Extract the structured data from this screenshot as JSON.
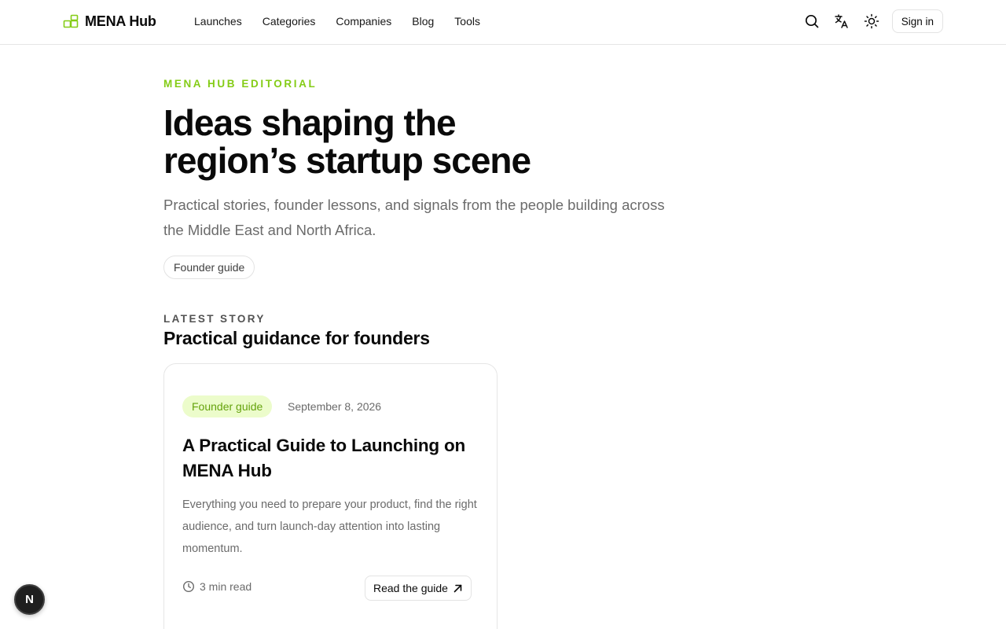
{
  "header": {
    "brand": "MENA Hub",
    "nav": [
      "Launches",
      "Categories",
      "Companies",
      "Blog",
      "Tools"
    ],
    "icons": [
      "search-icon",
      "translate-icon",
      "sun-icon"
    ],
    "signin_label": "Sign in"
  },
  "hero": {
    "eyebrow": "MENA HUB EDITORIAL",
    "title_line1": "Ideas shaping the",
    "title_line2": "region’s startup scene",
    "subtitle": "Practical stories, founder lessons, and signals from the people building across the Middle East and North Africa.",
    "filter_pill": "Founder guide"
  },
  "latest": {
    "label": "LATEST STORY",
    "title": "Practical guidance for founders",
    "card": {
      "tag": "Founder guide",
      "date": "September 8, 2026",
      "title": "A Practical Guide to Launching on MENA Hub",
      "description": "Everything you need to prepare your product, find the right audience, and turn launch-day attention into lasting momentum.",
      "read_time": "3 min read",
      "cta": "Read the guide"
    }
  },
  "floating_badge": "N",
  "colors": {
    "accent": "#84cc16",
    "tag_bg": "#ecfccb",
    "tag_text": "#65a30d",
    "text": "#0a0a0a",
    "muted": "#6b6b6b"
  }
}
